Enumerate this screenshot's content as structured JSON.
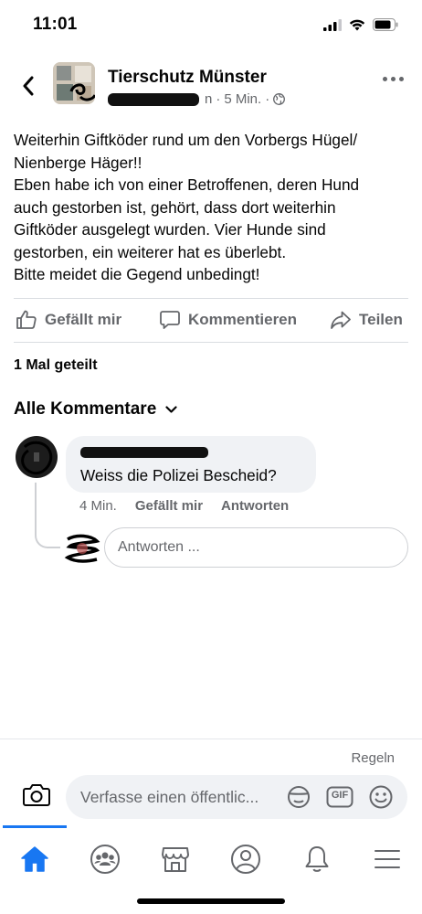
{
  "status_bar": {
    "time": "11:01"
  },
  "post": {
    "page_name": "Tierschutz Münster",
    "meta_suffix": "n",
    "time_ago": "5 Min.",
    "dot": "·",
    "text_lines": [
      "Weiterhin Giftköder rund um den Vorbergs Hügel/",
      "Nienberge Häger!!",
      "Eben habe ich von einer Betroffenen, deren Hund",
      "auch gestorben ist, gehört, dass dort weiterhin",
      "Giftköder ausgelegt wurden. Vier Hunde sind",
      "gestorben, ein weiterer hat es überlebt.",
      "Bitte meidet die Gegend unbedingt!"
    ]
  },
  "actions": {
    "like": "Gefällt mir",
    "comment": "Kommentieren",
    "share": "Teilen"
  },
  "share_count": "1 Mal geteilt",
  "comments_filter": "Alle Kommentare",
  "comment": {
    "text": "Weiss die Polizei Bescheid?",
    "time": "4 Min.",
    "like": "Gefällt mir",
    "reply": "Antworten"
  },
  "reply_input": {
    "placeholder": "Antworten ..."
  },
  "rules_link": "Regeln",
  "composer": {
    "placeholder": "Verfasse einen öffentlic...",
    "gif_label": "GIF"
  },
  "tabs": [
    "home-icon",
    "groups-icon",
    "marketplace-icon",
    "profile-icon",
    "notifications-icon",
    "menu-icon"
  ],
  "colors": {
    "accent": "#1877f2",
    "secondary_text": "#65676b",
    "bubble": "#f0f2f5"
  }
}
